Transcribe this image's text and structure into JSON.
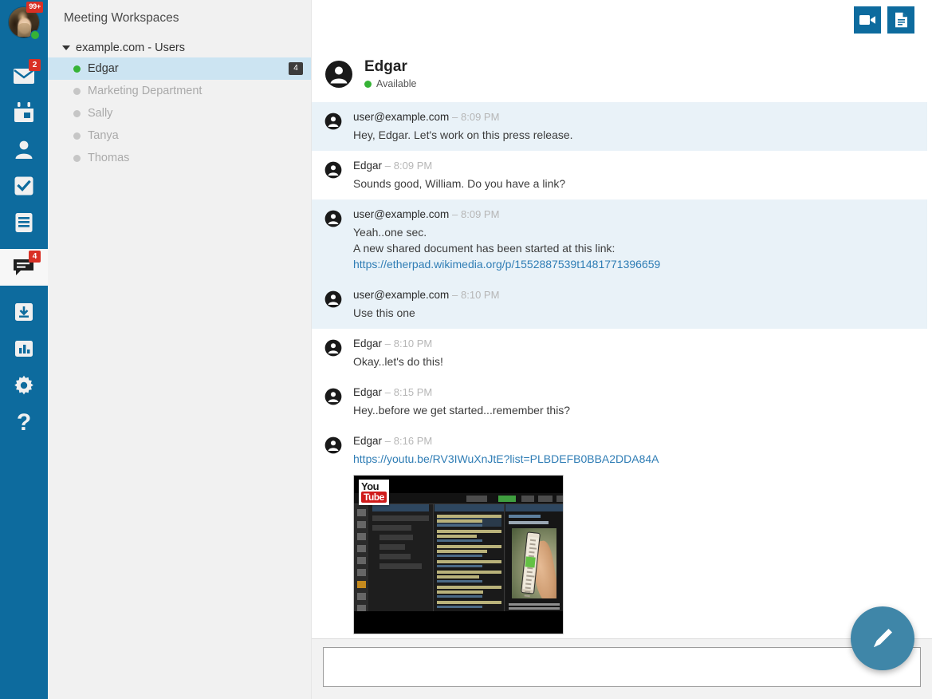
{
  "rail": {
    "avatar": {
      "name": "user-avatar",
      "badge": "99+",
      "presence": "online"
    },
    "items": [
      {
        "icon": "mail-icon",
        "label": "Mail",
        "badge": "2",
        "active": false
      },
      {
        "icon": "calendar-icon",
        "label": "Calendar",
        "badge": "",
        "active": false
      },
      {
        "icon": "contacts-icon",
        "label": "Contacts",
        "badge": "",
        "active": false
      },
      {
        "icon": "tasks-icon",
        "label": "Tasks",
        "badge": "",
        "active": false
      },
      {
        "icon": "notes-icon",
        "label": "Notes",
        "badge": "",
        "active": false
      },
      {
        "icon": "chat-icon",
        "label": "Chat",
        "badge": "4",
        "active": true
      },
      {
        "icon": "inbox-download-icon",
        "label": "Archive",
        "badge": "",
        "active": false
      },
      {
        "icon": "chart-icon",
        "label": "Reports",
        "badge": "",
        "active": false
      },
      {
        "icon": "gear-icon",
        "label": "Settings",
        "badge": "",
        "active": false
      },
      {
        "icon": "help-icon",
        "label": "Help",
        "badge": "",
        "active": false
      }
    ]
  },
  "listpanel": {
    "title": "Meeting Workspaces",
    "group": {
      "label": "example.com - Users",
      "expanded": true
    },
    "users": [
      {
        "name": "Edgar",
        "presence": "online",
        "badge": "4",
        "selected": true
      },
      {
        "name": "Marketing Department",
        "presence": "offline",
        "badge": "",
        "selected": false
      },
      {
        "name": "Sally",
        "presence": "offline",
        "badge": "",
        "selected": false
      },
      {
        "name": "Tanya",
        "presence": "offline",
        "badge": "",
        "selected": false
      },
      {
        "name": "Thomas",
        "presence": "offline",
        "badge": "",
        "selected": false
      }
    ]
  },
  "header": {
    "peer_name": "Edgar",
    "peer_status": "Available",
    "actions": [
      {
        "icon": "video-camera-icon",
        "label": "Start video call"
      },
      {
        "icon": "document-icon",
        "label": "Shared document"
      }
    ]
  },
  "messages": [
    {
      "sender": "user@example.com",
      "time": "8:09 PM",
      "separator": "–",
      "tinted": true,
      "lines": [
        {
          "text": "Hey, Edgar. Let's work on this press release.",
          "kind": "text"
        }
      ]
    },
    {
      "sender": "Edgar",
      "time": "8:09 PM",
      "separator": "–",
      "tinted": false,
      "lines": [
        {
          "text": "Sounds good, William. Do you have a link?",
          "kind": "text"
        }
      ]
    },
    {
      "sender": "user@example.com",
      "time": "8:09 PM",
      "separator": "–",
      "tinted": true,
      "lines": [
        {
          "text": "Yeah..one sec.",
          "kind": "text"
        },
        {
          "text": "A new shared document has been started at this link:",
          "kind": "text"
        },
        {
          "text": "https://etherpad.wikimedia.org/p/1552887539t1481771396659",
          "kind": "link"
        }
      ]
    },
    {
      "sender": "user@example.com",
      "time": "8:10 PM",
      "separator": "–",
      "tinted": true,
      "lines": [
        {
          "text": "Use this one",
          "kind": "text"
        }
      ]
    },
    {
      "sender": "Edgar",
      "time": "8:10 PM",
      "separator": "–",
      "tinted": false,
      "lines": [
        {
          "text": "Okay..let's do this!",
          "kind": "text"
        }
      ]
    },
    {
      "sender": "Edgar",
      "time": "8:15 PM",
      "separator": "–",
      "tinted": false,
      "lines": [
        {
          "text": "Hey..before we get started...remember this?",
          "kind": "text"
        }
      ]
    },
    {
      "sender": "Edgar",
      "time": "8:16 PM",
      "separator": "–",
      "tinted": false,
      "lines": [
        {
          "text": "https://youtu.be/RV3IWuXnJtE?list=PLBDEFB0BBA2DDA84A",
          "kind": "link"
        }
      ],
      "attachment": {
        "type": "video-thumbnail",
        "provider": "YouTube",
        "logo_you": "You",
        "logo_tube": "Tube"
      }
    }
  ],
  "composer": {
    "value": "",
    "placeholder": ""
  },
  "fab": {
    "icon": "pencil-icon",
    "label": "Compose"
  },
  "colors": {
    "rail_blue": "#0d6b9e",
    "accent_link": "#2f7db5",
    "tinted_row": "#e9f2f8",
    "selected_row": "#cce4f2",
    "badge_red": "#d93025",
    "presence_green": "#36b336",
    "fab_blue": "#3f86a8",
    "panel_gray": "#f1f1f1"
  }
}
